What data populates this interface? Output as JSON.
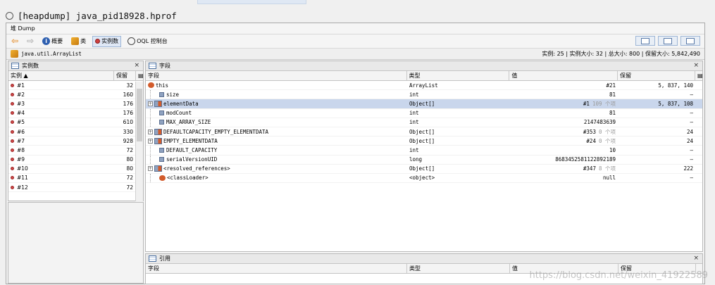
{
  "window": {
    "title": "[heapdump] java_pid18928.hprof"
  },
  "tabs": {
    "heap_tab": "堆 Dump"
  },
  "toolbar": {
    "summary_label": "概要",
    "classes_label": "类",
    "instances_label": "实例数",
    "oql_label": "OQL 控制台"
  },
  "classbar": {
    "class_name": "java.util.ArrayList",
    "summary": "实例: 25  |  实例大小: 32  |  总大小: 800  |  保留大小: 5,842,490"
  },
  "instances_panel": {
    "title": "实例数",
    "col_instance": "实例",
    "col_retained": "保留",
    "rows": [
      {
        "id": "#1",
        "retained": "32"
      },
      {
        "id": "#2",
        "retained": "160"
      },
      {
        "id": "#3",
        "retained": "176"
      },
      {
        "id": "#4",
        "retained": "176"
      },
      {
        "id": "#5",
        "retained": "610"
      },
      {
        "id": "#6",
        "retained": "330"
      },
      {
        "id": "#7",
        "retained": "928"
      },
      {
        "id": "#8",
        "retained": "72"
      },
      {
        "id": "#9",
        "retained": "80"
      },
      {
        "id": "#10",
        "retained": "80"
      },
      {
        "id": "#11",
        "retained": "72"
      },
      {
        "id": "#12",
        "retained": "72"
      }
    ]
  },
  "fields_panel": {
    "title": "字段",
    "col_field": "字段",
    "col_type": "类型",
    "col_value": "值",
    "col_retained": "保留",
    "rows": [
      {
        "name": "this",
        "type": "ArrayList",
        "value": "#21",
        "extra": "",
        "retained": "5, 837, 140"
      },
      {
        "name": "size",
        "type": "int",
        "value": "81",
        "extra": "",
        "retained": "–"
      },
      {
        "name": "elementData",
        "type": "Object[]",
        "value": "#1",
        "extra": "109 个项",
        "retained": "5, 837, 108"
      },
      {
        "name": "modCount",
        "type": "int",
        "value": "81",
        "extra": "",
        "retained": "–"
      },
      {
        "name": "MAX_ARRAY_SIZE",
        "type": "int",
        "value": "2147483639",
        "extra": "",
        "retained": "–"
      },
      {
        "name": "DEFAULTCAPACITY_EMPTY_ELEMENTDATA",
        "type": "Object[]",
        "value": "#353",
        "extra": "0 个项",
        "retained": "24"
      },
      {
        "name": "EMPTY_ELEMENTDATA",
        "type": "Object[]",
        "value": "#24",
        "extra": "0 个项",
        "retained": "24"
      },
      {
        "name": "DEFAULT_CAPACITY",
        "type": "int",
        "value": "10",
        "extra": "",
        "retained": "–"
      },
      {
        "name": "serialVersionUID",
        "type": "long",
        "value": "8683452581122892189",
        "extra": "",
        "retained": "–"
      },
      {
        "name": "<resolved_references>",
        "type": "Object[]",
        "value": "#347",
        "extra": "8 个项",
        "retained": "222"
      },
      {
        "name": "<classLoader>",
        "type": "<object>",
        "value": "null",
        "extra": "",
        "retained": "–"
      }
    ]
  },
  "refs_panel": {
    "title": "引用",
    "col_field": "字段",
    "col_type": "类型",
    "col_value": "值",
    "col_retained": "保留"
  },
  "watermark": "https://blog.csdn.net/weixin_41922589"
}
